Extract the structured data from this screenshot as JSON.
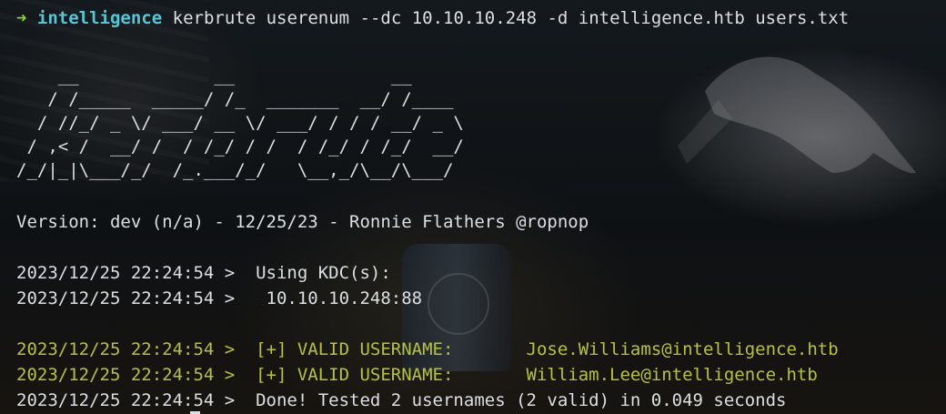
{
  "terminal": {
    "prompt": {
      "arrow": "➜",
      "directory": "intelligence",
      "command": "kerbrute userenum --dc 10.10.10.248 -d intelligence.htb users.txt"
    },
    "banner_lines": [
      "    __             __               __",
      "   / /_____  _____/ /_  _______  __/ /____",
      "  / //_/ _ \\/ ___/ __ \\/ ___/ / / / __/ _ \\",
      " / ,< /  __/ /  / /_/ / /  / /_/ / /_/  __/",
      "/_/|_|\\___/_/  /_.___/_/   \\__,_/\\__/\\___/"
    ],
    "version_line": "Version: dev (n/a) - 12/25/23 - Ronnie Flathers @ropnop",
    "log": {
      "kdc_header": "2023/12/25 22:24:54 >  Using KDC(s):",
      "kdc_address": "2023/12/25 22:24:54 >   10.10.10.248:88",
      "valid_user_1": "2023/12/25 22:24:54 >  [+] VALID USERNAME:       Jose.Williams@intelligence.htb",
      "valid_user_2": "2023/12/25 22:24:54 >  [+] VALID USERNAME:       William.Lee@intelligence.htb",
      "summary": "2023/12/25 22:24:54 >  Done! Tested 2 usernames (2 valid) in 0.049 seconds"
    }
  },
  "colors": {
    "prompt_arrow": "#8ad23a",
    "prompt_directory": "#58c5d6",
    "foreground": "#dcdfe3",
    "valid_highlight": "#b6c23f",
    "background": "#0d1115"
  }
}
